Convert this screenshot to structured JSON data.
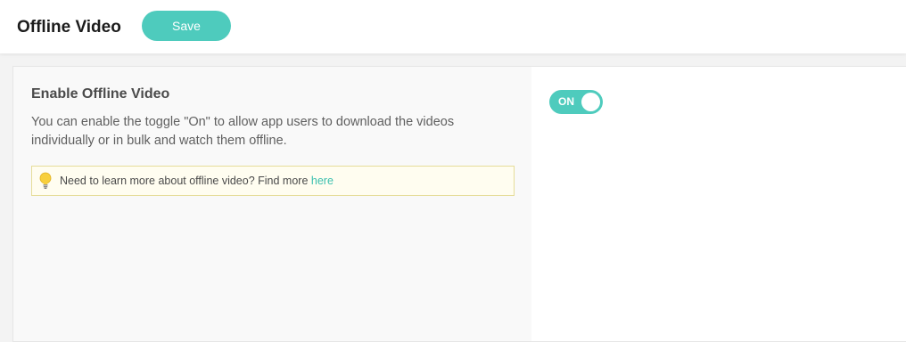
{
  "header": {
    "title": "Offline Video",
    "save_label": "Save"
  },
  "section": {
    "title": "Enable Offline Video",
    "description": "You can enable the toggle \"On\" to allow app users to download the videos individually or in bulk and watch them offline.",
    "info_text": "Need to learn more about offline video? Find more ",
    "info_link": "here",
    "info_icon": "lightbulb-icon"
  },
  "toggle": {
    "label": "ON",
    "state": true
  },
  "colors": {
    "accent": "#4ecbbd",
    "link": "#39bfae",
    "info_bg": "#fffdf0",
    "info_border": "#e6dd9a"
  }
}
